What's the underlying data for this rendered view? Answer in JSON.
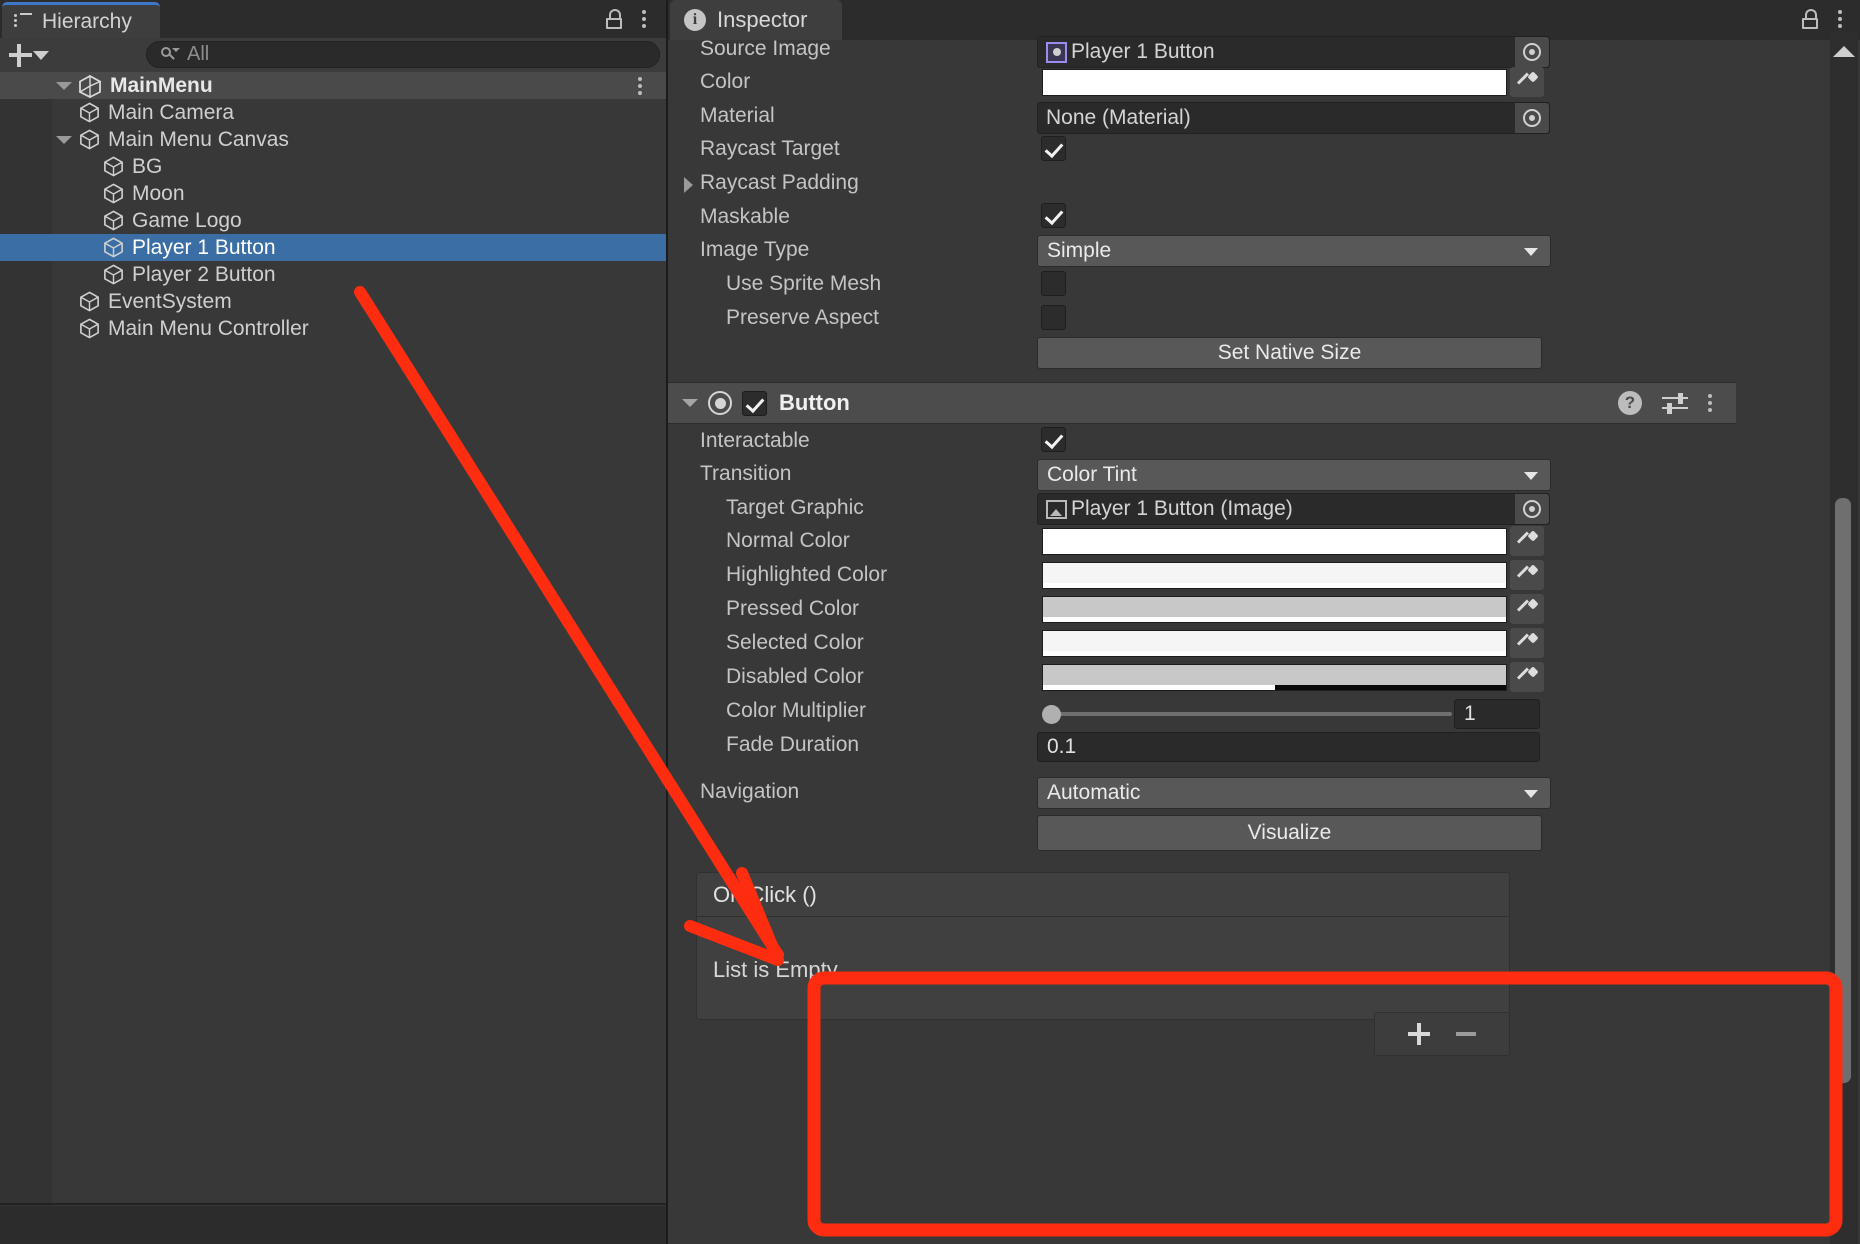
{
  "hierarchy": {
    "tab_label": "Hierarchy",
    "tab_icon": "hierarchy-list-icon",
    "add_label": "+",
    "search": {
      "value": "",
      "placeholder": "All"
    },
    "scene": {
      "name": "MainMenu",
      "expanded": true
    },
    "items": [
      {
        "label": "Main Camera",
        "depth": 1,
        "expandable": false,
        "selected": false
      },
      {
        "label": "Main Menu Canvas",
        "depth": 1,
        "expandable": true,
        "selected": false
      },
      {
        "label": "BG",
        "depth": 2,
        "expandable": false,
        "selected": false
      },
      {
        "label": "Moon",
        "depth": 2,
        "expandable": false,
        "selected": false
      },
      {
        "label": "Game Logo",
        "depth": 2,
        "expandable": false,
        "selected": false
      },
      {
        "label": "Player 1 Button",
        "depth": 2,
        "expandable": false,
        "selected": true
      },
      {
        "label": "Player 2 Button",
        "depth": 2,
        "expandable": false,
        "selected": false
      },
      {
        "label": "EventSystem",
        "depth": 1,
        "expandable": false,
        "selected": false
      },
      {
        "label": "Main Menu Controller",
        "depth": 1,
        "expandable": false,
        "selected": false
      }
    ]
  },
  "inspector": {
    "tab_label": "Inspector",
    "image_component": {
      "rows": {
        "source_image_label": "Source Image",
        "source_image_value": "Player 1 Button",
        "color_label": "Color",
        "color_value": "#FFFFFF",
        "material_label": "Material",
        "material_value": "None (Material)",
        "raycast_target_label": "Raycast Target",
        "raycast_target_checked": "true",
        "raycast_padding_label": "Raycast Padding",
        "maskable_label": "Maskable",
        "maskable_checked": "true",
        "image_type_label": "Image Type",
        "image_type_value": "Simple",
        "use_sprite_mesh_label": "Use Sprite Mesh",
        "use_sprite_mesh_checked": "false",
        "preserve_aspect_label": "Preserve Aspect",
        "preserve_aspect_checked": "false",
        "set_native_size_label": "Set Native Size"
      }
    },
    "button_component": {
      "title": "Button",
      "enabled": "true",
      "interactable_label": "Interactable",
      "interactable_checked": "true",
      "transition_label": "Transition",
      "transition_value": "Color Tint",
      "target_graphic_label": "Target Graphic",
      "target_graphic_value": "Player 1 Button (Image)",
      "colors": [
        {
          "label": "Normal Color",
          "hex": "#FFFFFF",
          "alpha_pct": 100
        },
        {
          "label": "Highlighted Color",
          "hex": "#F5F5F5",
          "alpha_pct": 100
        },
        {
          "label": "Pressed Color",
          "hex": "#C8C8C8",
          "alpha_pct": 100
        },
        {
          "label": "Selected Color",
          "hex": "#F5F5F5",
          "alpha_pct": 100
        },
        {
          "label": "Disabled Color",
          "hex": "#C8C8C8",
          "alpha_pct": 50
        }
      ],
      "color_multiplier_label": "Color Multiplier",
      "color_multiplier_value": "1",
      "fade_duration_label": "Fade Duration",
      "fade_duration_value": "0.1",
      "navigation_label": "Navigation",
      "navigation_value": "Automatic",
      "visualize_label": "Visualize",
      "on_click_label": "On Click ()",
      "on_click_empty_label": "List is Empty",
      "add_listener_label": "+",
      "remove_listener_label": "−"
    }
  },
  "annotations": {
    "accent_color": "#FF2D10",
    "highlight_box": "on-click-section-highlight",
    "arrow": "arrow-from-player-1-button-to-on-click"
  }
}
